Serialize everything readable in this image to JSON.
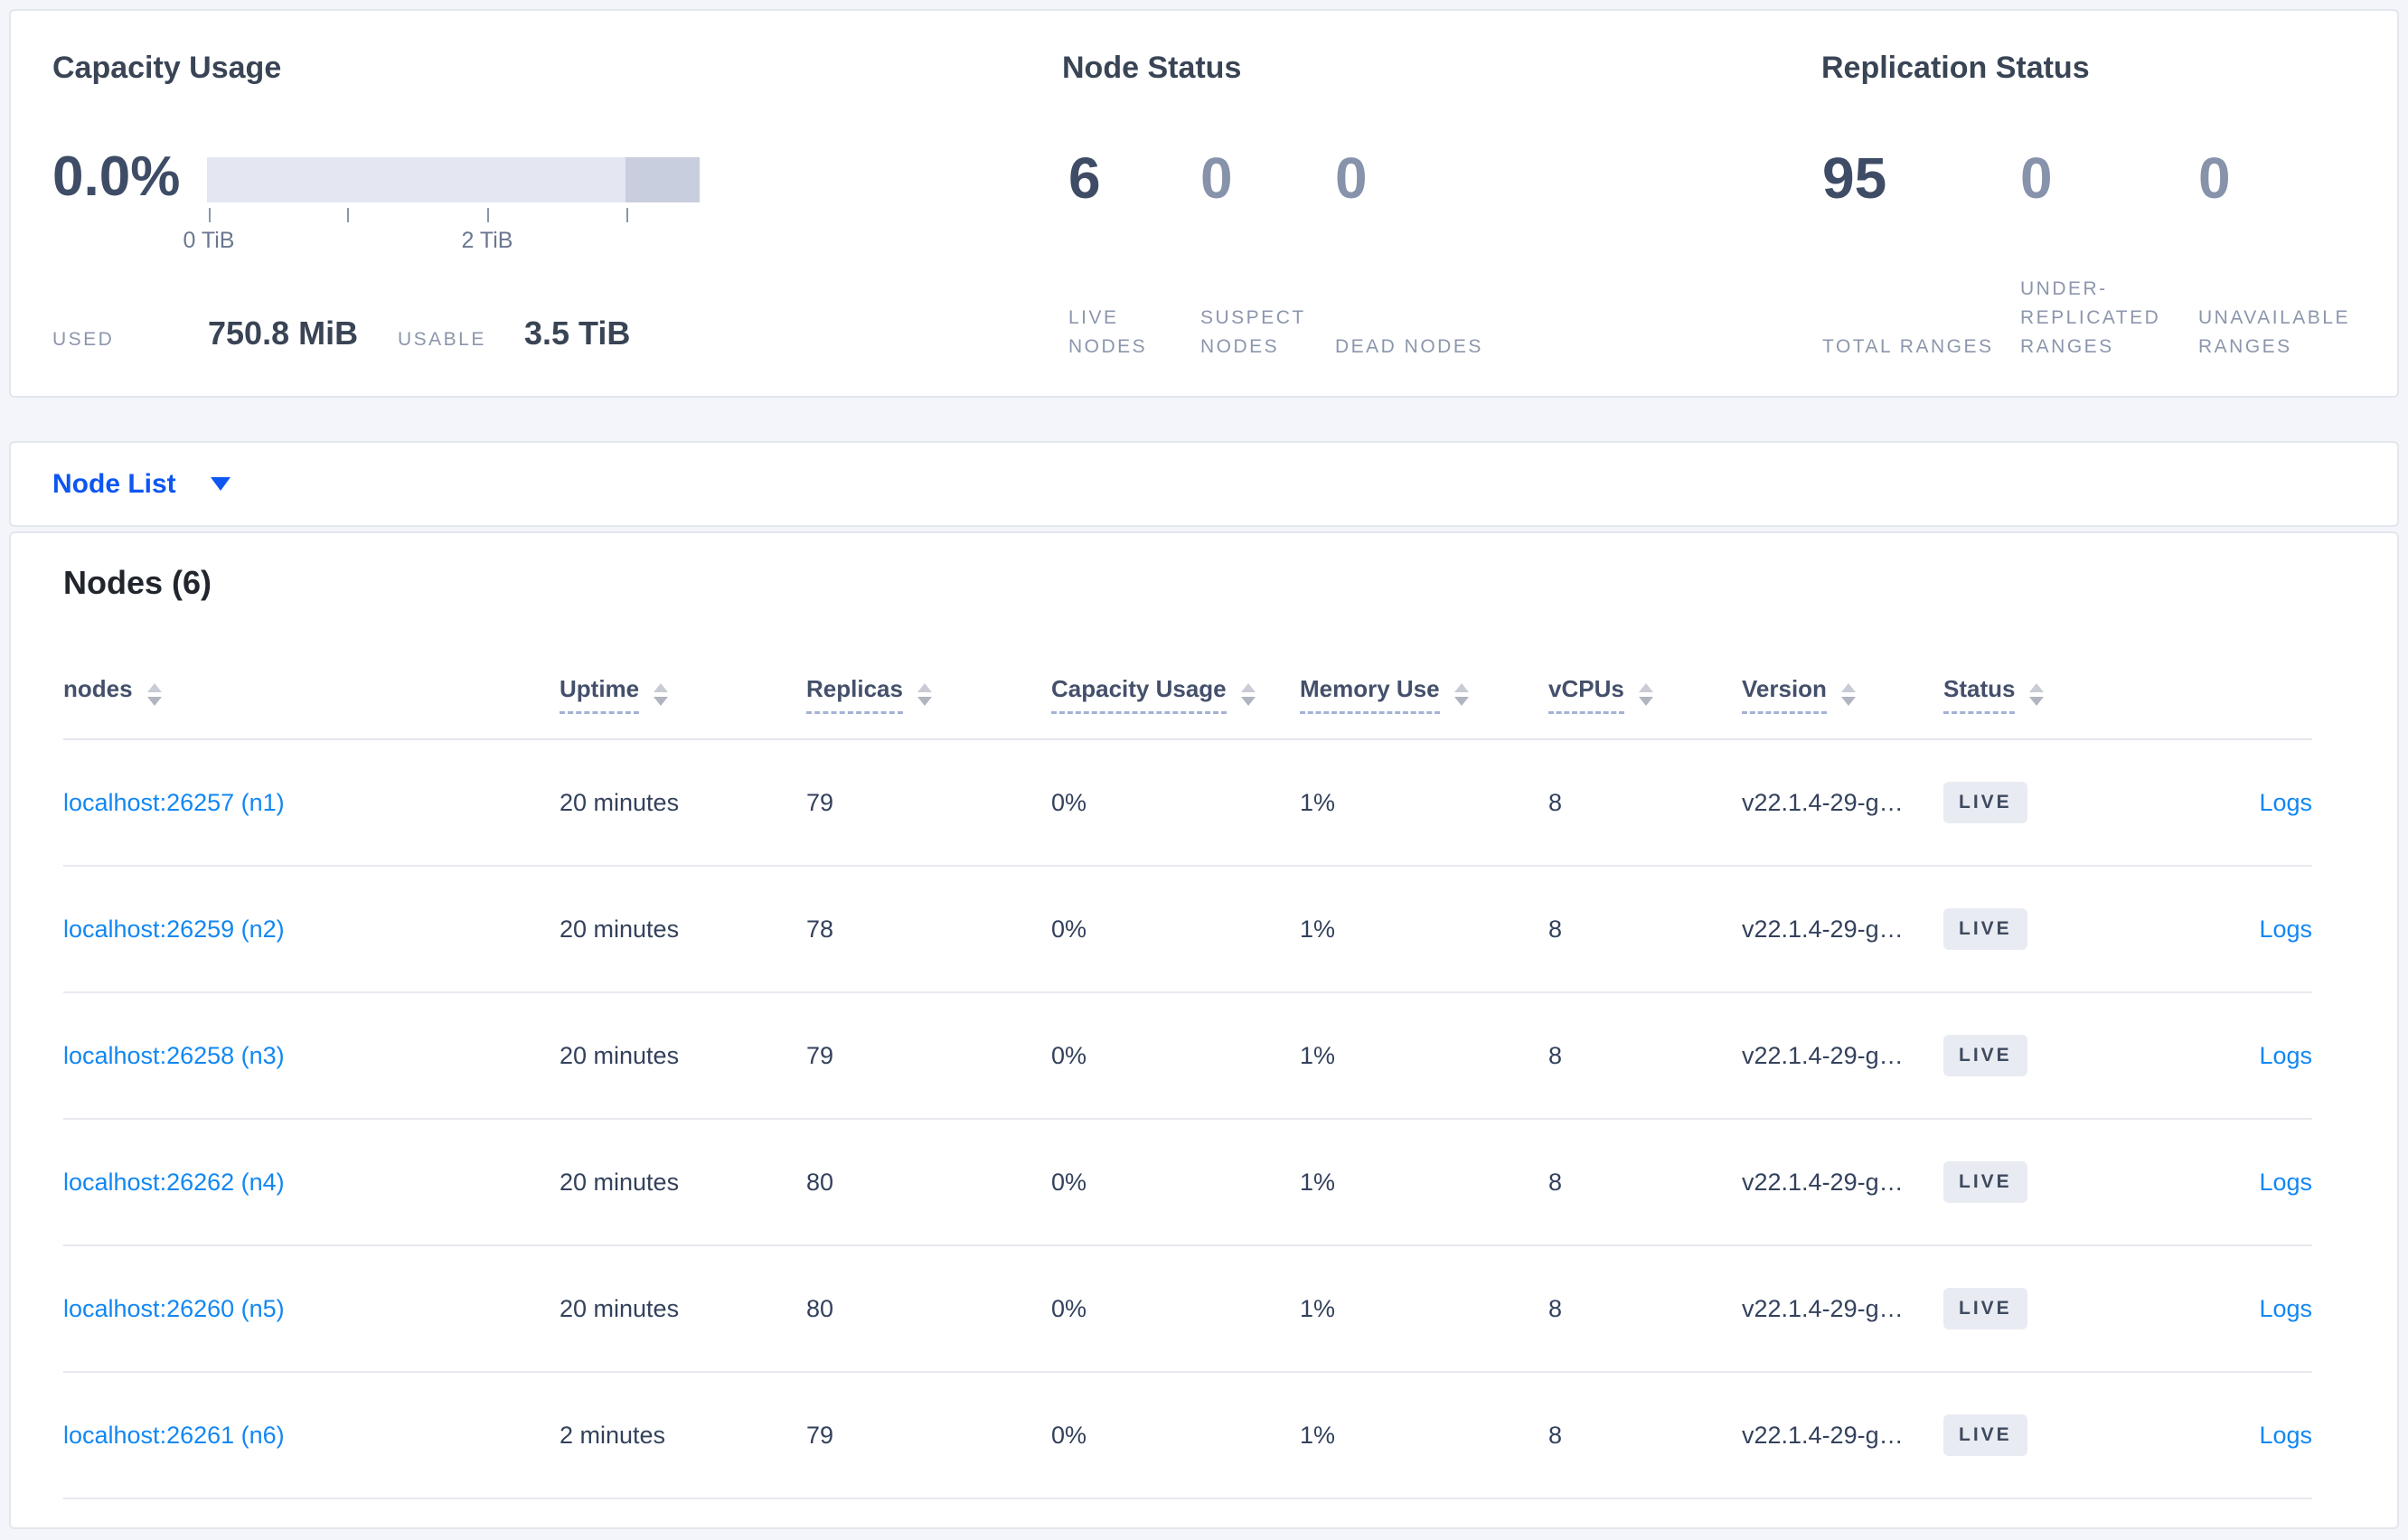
{
  "colors": {
    "page_bg": "#f4f5fa",
    "card_bg": "#ffffff",
    "card_border": "#e3e6ed",
    "title": "#394455",
    "stat_strong": "#3e4c66",
    "stat_muted": "#8792ab",
    "stat_label": "#8c96ac",
    "bar_bg": "#e4e7f1",
    "bar_cap": "#c9cede",
    "tick": "#8b96ad",
    "tick_label": "#6b7791",
    "nav_blue": "#0d56f0",
    "link_blue": "#1287f2",
    "heading": "#21262d",
    "header_text": "#44506b",
    "cell_text": "#33415c",
    "row_line": "#e7e9ef",
    "badge_bg": "#e9ebf2",
    "badge_text": "#3e4a5e"
  },
  "capacity_panel": {
    "title": "Capacity Usage",
    "percent": "0.0%",
    "tick0_label": "0 TiB",
    "tick2_label": "2 TiB",
    "used_label": "USED",
    "used_value": "750.8 MiB",
    "usable_label": "USABLE",
    "usable_value": "3.5 TiB"
  },
  "node_status_panel": {
    "title": "Node Status",
    "stats": [
      {
        "value": "6",
        "label": "LIVE NODES",
        "emphasis": "strong"
      },
      {
        "value": "0",
        "label": "SUSPECT NODES",
        "emphasis": "muted"
      },
      {
        "value": "0",
        "label": "DEAD NODES",
        "emphasis": "muted"
      }
    ]
  },
  "replication_panel": {
    "title": "Replication Status",
    "stats": [
      {
        "value": "95",
        "label": "TOTAL RANGES",
        "emphasis": "strong"
      },
      {
        "value": "0",
        "label": "UNDER-REPLICATED RANGES",
        "emphasis": "muted"
      },
      {
        "value": "0",
        "label": "UNAVAILABLE RANGES",
        "emphasis": "muted"
      }
    ]
  },
  "node_list": {
    "label": "Node List"
  },
  "nodes_section": {
    "heading": "Nodes (6)",
    "columns": [
      {
        "label": "nodes",
        "sortable": true,
        "dotted": false
      },
      {
        "label": "Uptime",
        "sortable": true,
        "dotted": true
      },
      {
        "label": "Replicas",
        "sortable": true,
        "dotted": true
      },
      {
        "label": "Capacity Usage",
        "sortable": true,
        "dotted": true
      },
      {
        "label": "Memory Use",
        "sortable": true,
        "dotted": true
      },
      {
        "label": "vCPUs",
        "sortable": true,
        "dotted": true
      },
      {
        "label": "Version",
        "sortable": true,
        "dotted": true
      },
      {
        "label": "Status",
        "sortable": true,
        "dotted": true
      }
    ],
    "logs_column_label": "Logs",
    "rows": [
      {
        "node": "localhost:26257 (n1)",
        "uptime": "20 minutes",
        "replicas": "79",
        "capacity": "0%",
        "memory": "1%",
        "vcpus": "8",
        "version": "v22.1.4-29-g…",
        "status": "LIVE",
        "logs": "Logs"
      },
      {
        "node": "localhost:26259 (n2)",
        "uptime": "20 minutes",
        "replicas": "78",
        "capacity": "0%",
        "memory": "1%",
        "vcpus": "8",
        "version": "v22.1.4-29-g…",
        "status": "LIVE",
        "logs": "Logs"
      },
      {
        "node": "localhost:26258 (n3)",
        "uptime": "20 minutes",
        "replicas": "79",
        "capacity": "0%",
        "memory": "1%",
        "vcpus": "8",
        "version": "v22.1.4-29-g…",
        "status": "LIVE",
        "logs": "Logs"
      },
      {
        "node": "localhost:26262 (n4)",
        "uptime": "20 minutes",
        "replicas": "80",
        "capacity": "0%",
        "memory": "1%",
        "vcpus": "8",
        "version": "v22.1.4-29-g…",
        "status": "LIVE",
        "logs": "Logs"
      },
      {
        "node": "localhost:26260 (n5)",
        "uptime": "20 minutes",
        "replicas": "80",
        "capacity": "0%",
        "memory": "1%",
        "vcpus": "8",
        "version": "v22.1.4-29-g…",
        "status": "LIVE",
        "logs": "Logs"
      },
      {
        "node": "localhost:26261 (n6)",
        "uptime": "2 minutes",
        "replicas": "79",
        "capacity": "0%",
        "memory": "1%",
        "vcpus": "8",
        "version": "v22.1.4-29-g…",
        "status": "LIVE",
        "logs": "Logs"
      }
    ]
  }
}
